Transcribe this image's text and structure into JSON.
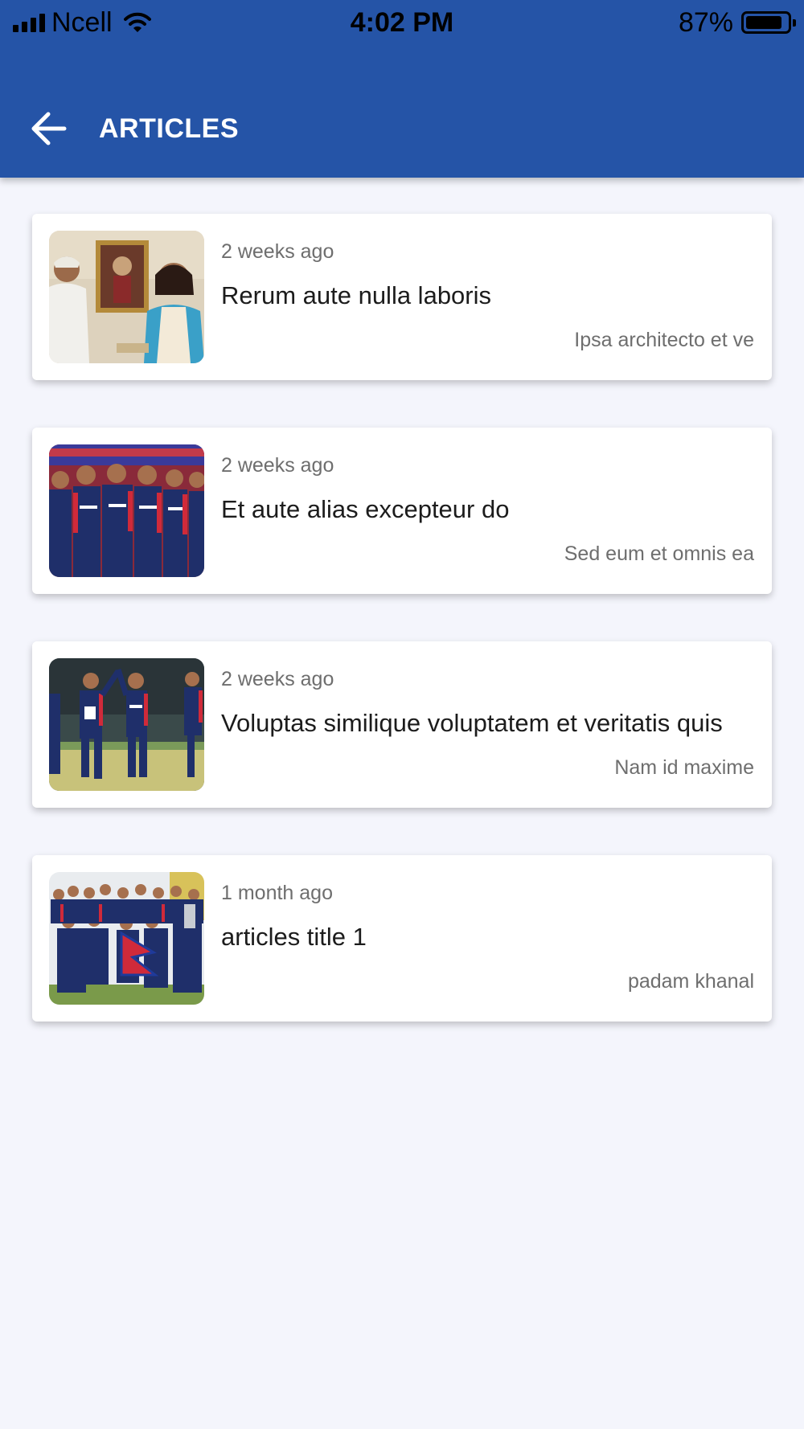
{
  "status_bar": {
    "carrier": "Ncell",
    "time": "4:02 PM",
    "battery_percent": "87%",
    "battery_level": 0.87,
    "signal_icon": "signal-bars-icon",
    "wifi_icon": "wifi-icon",
    "battery_icon": "battery-icon"
  },
  "header": {
    "title": "ARTICLES",
    "back_icon": "arrow-left-icon",
    "background_color": "#2554a7"
  },
  "articles": [
    {
      "time": "2 weeks ago",
      "title": "Rerum aute nulla laboris",
      "author": "Ipsa architecto et ve"
    },
    {
      "time": "2 weeks ago",
      "title": "Et aute alias excepteur do",
      "author": "Sed eum et omnis ea"
    },
    {
      "time": "2 weeks ago",
      "title": "Voluptas similique voluptatem et veritatis quis",
      "author": "Nam id maxime"
    },
    {
      "time": "1 month ago",
      "title": "articles title 1",
      "author": "padam khanal"
    }
  ]
}
